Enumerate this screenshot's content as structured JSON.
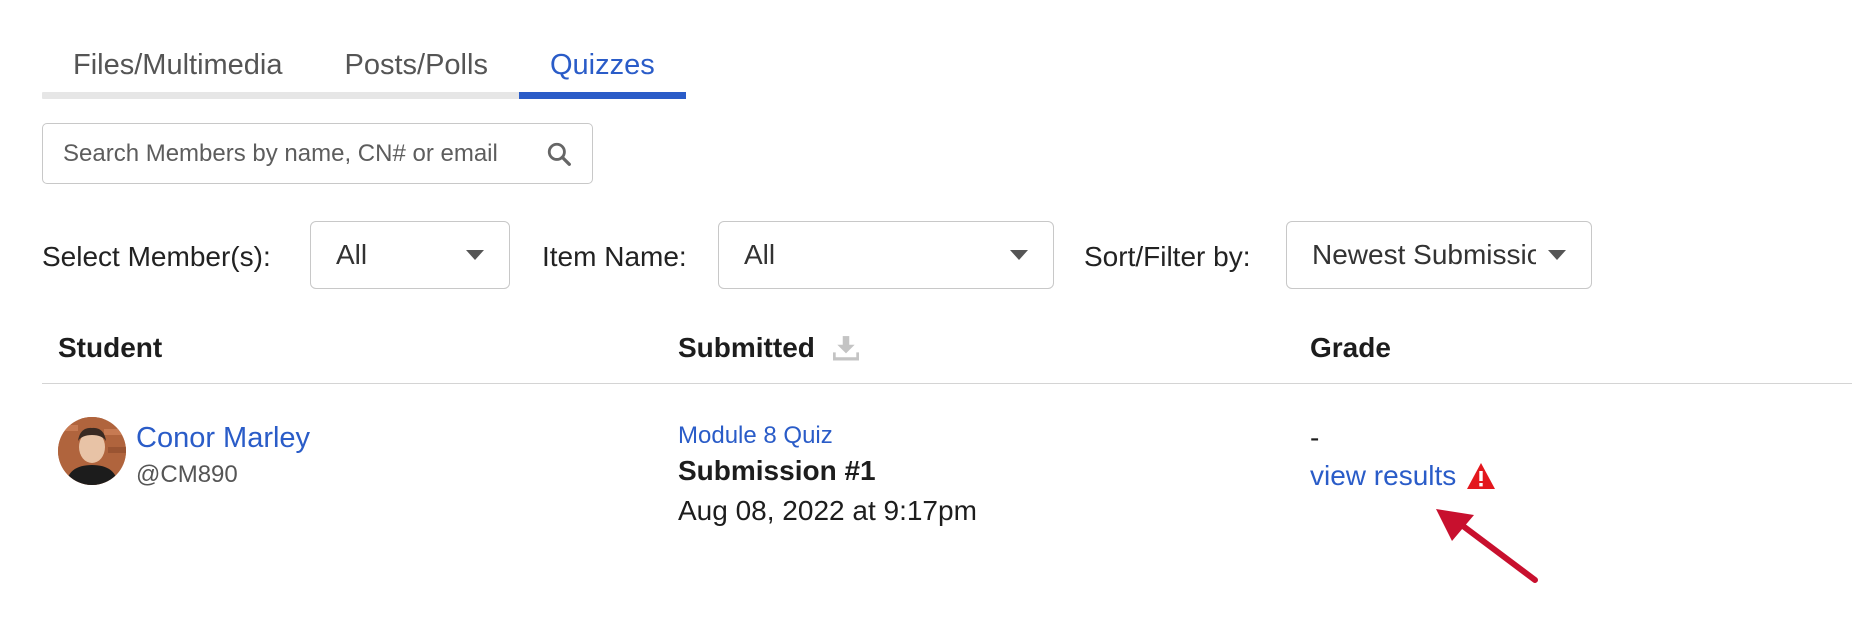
{
  "tabs": [
    {
      "label": "Files/Multimedia",
      "active": false
    },
    {
      "label": "Posts/Polls",
      "active": false
    },
    {
      "label": "Quizzes",
      "active": true
    }
  ],
  "search": {
    "placeholder": "Search Members by name, CN# or email",
    "icon": "search-icon"
  },
  "filters": {
    "member_label": "Select Member(s):",
    "member_value": "All",
    "item_label": "Item Name:",
    "item_value": "All",
    "sort_label": "Sort/Filter by:",
    "sort_value": "Newest Submission"
  },
  "table": {
    "headers": {
      "student": "Student",
      "submitted": "Submitted",
      "grade": "Grade"
    },
    "rows": [
      {
        "student_name": "Conor Marley",
        "student_handle": "@CM890",
        "quiz_name": "Module 8 Quiz",
        "submission": "Submission #1",
        "date": "Aug 08, 2022 at 9:17pm",
        "grade": "-",
        "view_results": "view results"
      }
    ]
  },
  "colors": {
    "accent": "#2a5cc8",
    "warning": "#e3171d",
    "annotation_arrow": "#c8102e"
  }
}
